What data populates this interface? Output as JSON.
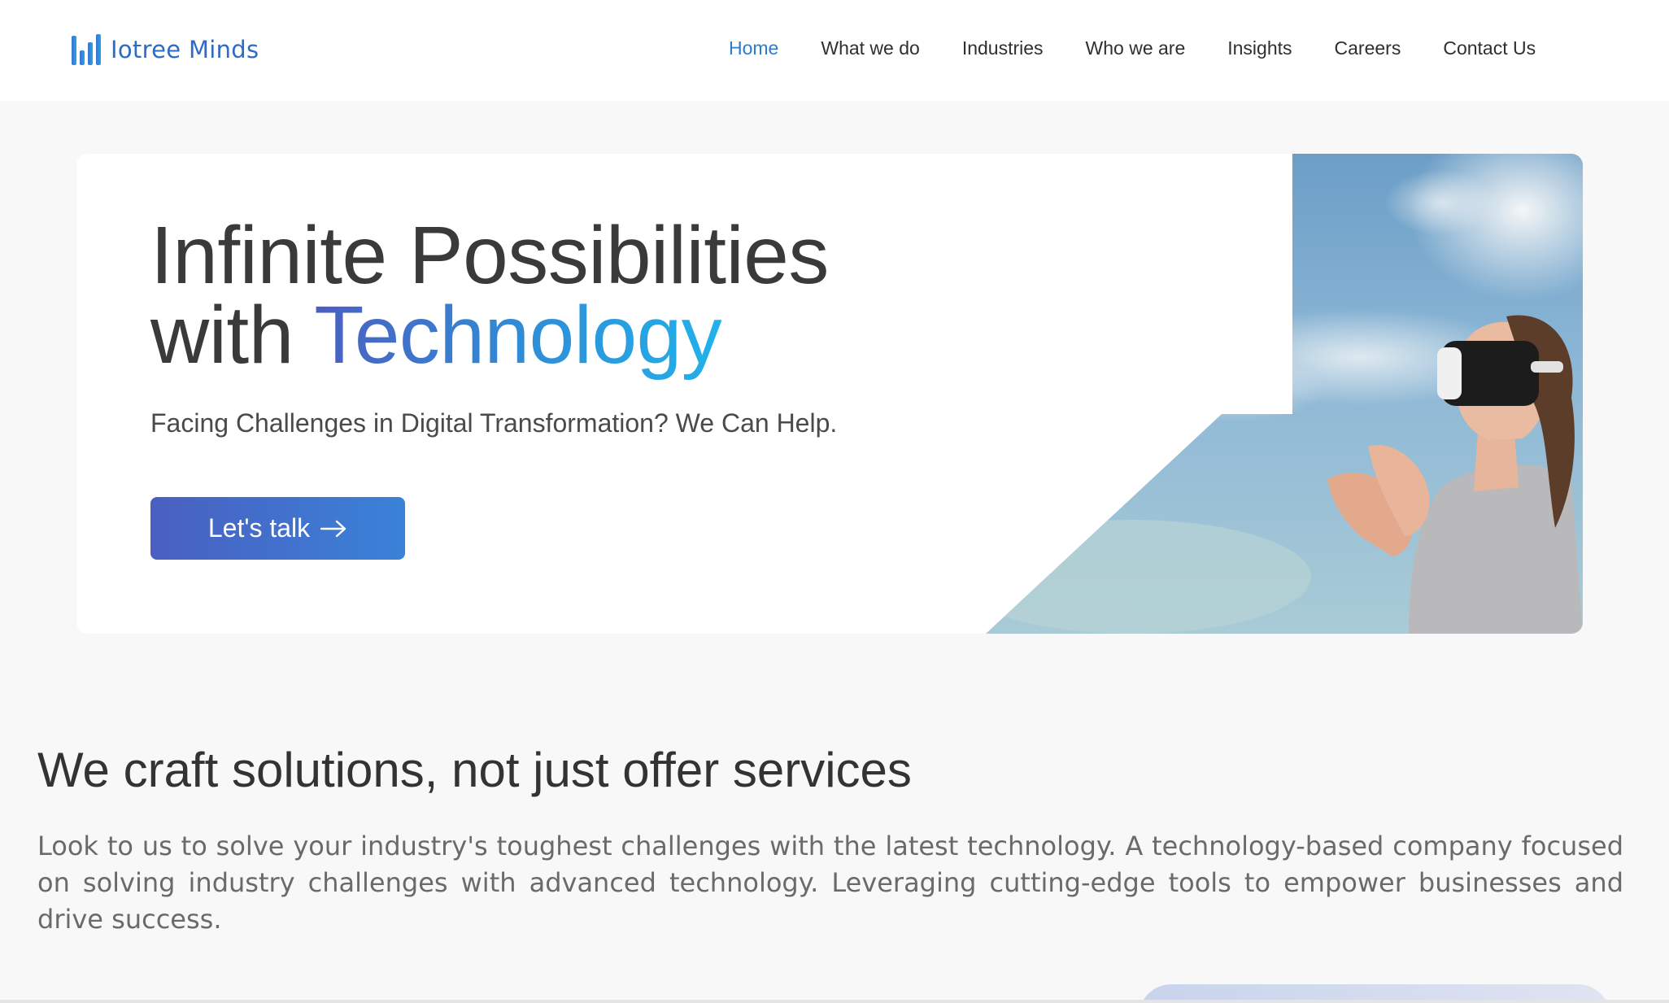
{
  "brand": {
    "name": "Iotree Minds",
    "colors": {
      "primary": "#2b7bd0",
      "accent_start": "#4b5fc0",
      "accent_end": "#21b2ea"
    }
  },
  "nav": {
    "items": [
      {
        "label": "Home",
        "active": true
      },
      {
        "label": "What we do",
        "active": false
      },
      {
        "label": "Industries",
        "active": false
      },
      {
        "label": "Who we are",
        "active": false
      },
      {
        "label": "Insights",
        "active": false
      },
      {
        "label": "Careers",
        "active": false
      },
      {
        "label": "Contact Us",
        "active": false
      }
    ]
  },
  "hero": {
    "title_line1": "Infinite Possibilities",
    "title_line2_prefix": "with ",
    "title_line2_accent": "Technology",
    "subtitle": "Facing Challenges in Digital Transformation? We Can Help.",
    "cta_label": "Let's talk",
    "cta_icon": "arrow-right-icon",
    "image": "woman-vr-headset-sky-photo"
  },
  "solutions": {
    "title": "We craft solutions, not just offer services",
    "body": "Look to us to solve your industry's toughest challenges with the latest technology. A technology-based company focused on solving industry challenges with advanced technology. Leveraging cutting-edge tools to empower businesses and drive success."
  }
}
